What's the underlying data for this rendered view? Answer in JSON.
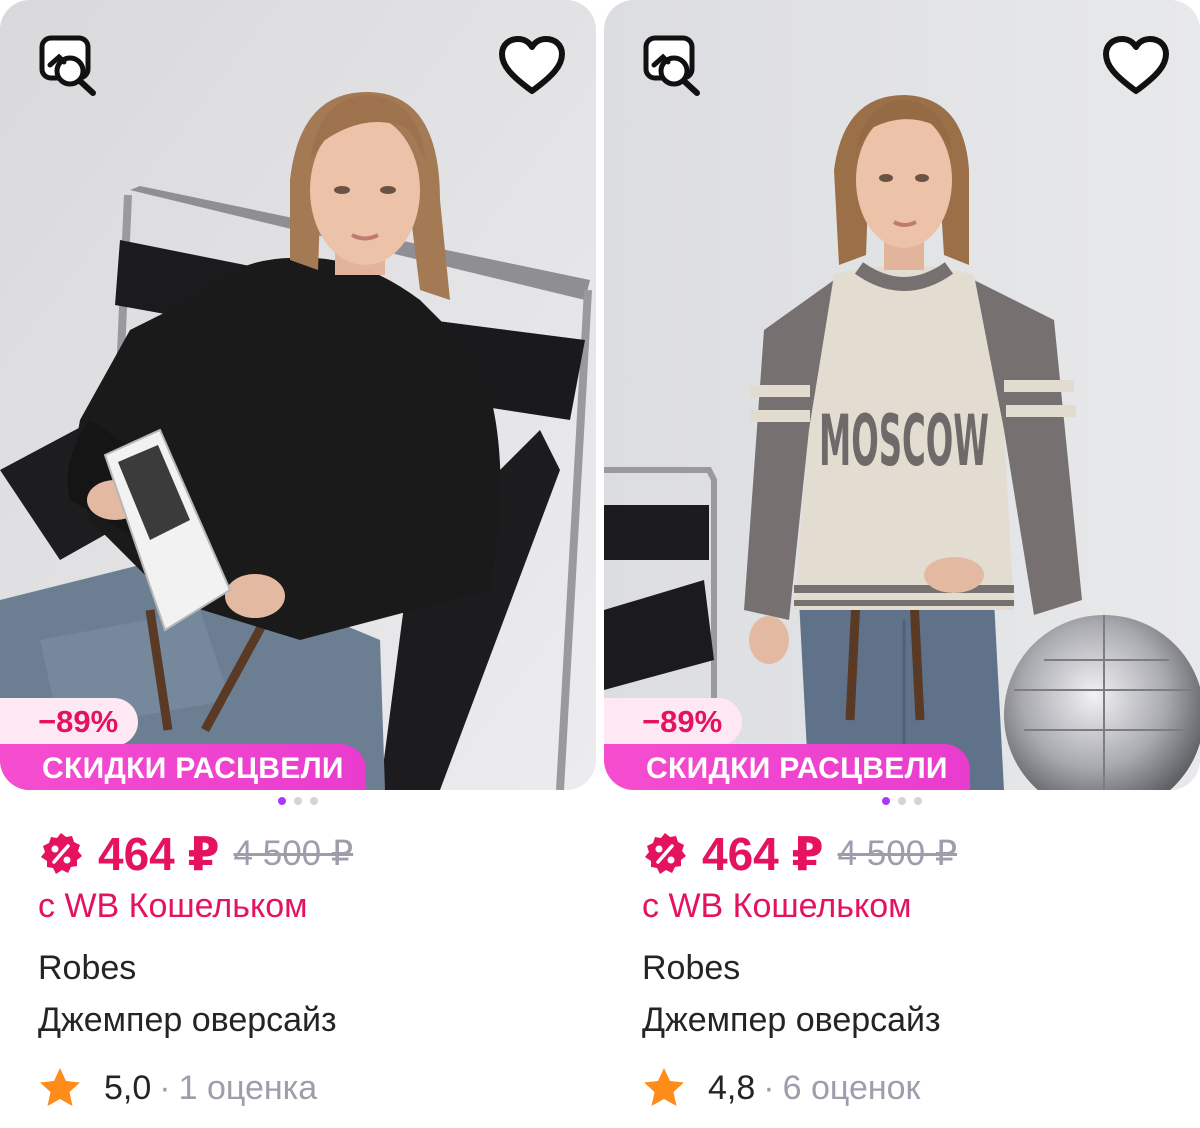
{
  "colors": {
    "price": "#e4125f",
    "promo": "#f24bd0",
    "dot_active": "#a73afd",
    "muted": "#9d9dac",
    "star": "#ff8c1a"
  },
  "products": [
    {
      "discount": "−89%",
      "promo": "СКИДКИ РАСЦВЕЛИ",
      "price": "464 ₽",
      "old_price": "4 500 ₽",
      "wallet_note": "с WB Кошельком",
      "brand": "Robes",
      "name": "Джемпер оверсайз",
      "rating": "5,0",
      "separator": "·",
      "reviews": "1 оценка",
      "icons": [
        "search-photo-icon",
        "heart-icon",
        "wallet-discount-icon",
        "star-icon"
      ]
    },
    {
      "discount": "−89%",
      "promo": "СКИДКИ РАСЦВЕЛИ",
      "price": "464 ₽",
      "old_price": "4 500 ₽",
      "wallet_note": "с WB Кошельком",
      "brand": "Robes",
      "name": "Джемпер оверсайз",
      "rating": "4,8",
      "separator": "·",
      "reviews": "6 оценок",
      "print_text": "MOSCOW",
      "icons": [
        "search-photo-icon",
        "heart-icon",
        "wallet-discount-icon",
        "star-icon"
      ]
    }
  ]
}
